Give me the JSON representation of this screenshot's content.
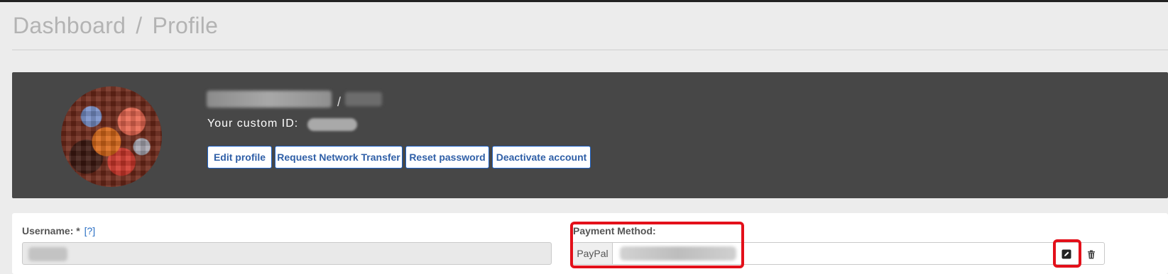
{
  "breadcrumb": {
    "root": "Dashboard",
    "separator": "/",
    "current": "Profile"
  },
  "profile": {
    "name_separator": "/",
    "custom_id_label": "Your custom ID:",
    "actions": {
      "edit_profile": "Edit profile",
      "request_network_transfer": "Request Network Transfer",
      "reset_password": "Reset password",
      "deactivate_account": "Deactivate account"
    }
  },
  "form": {
    "username_label": "Username:",
    "username_required": "*",
    "username_help": "[?]",
    "payment_method_label": "Payment Method:",
    "payment_method_addon": "PayPal"
  },
  "icons": {
    "edit": "edit-icon",
    "delete": "trash-icon"
  },
  "colors": {
    "accent": "#1e63c8",
    "highlight": "#e3101a",
    "card_dark": "#474747"
  }
}
